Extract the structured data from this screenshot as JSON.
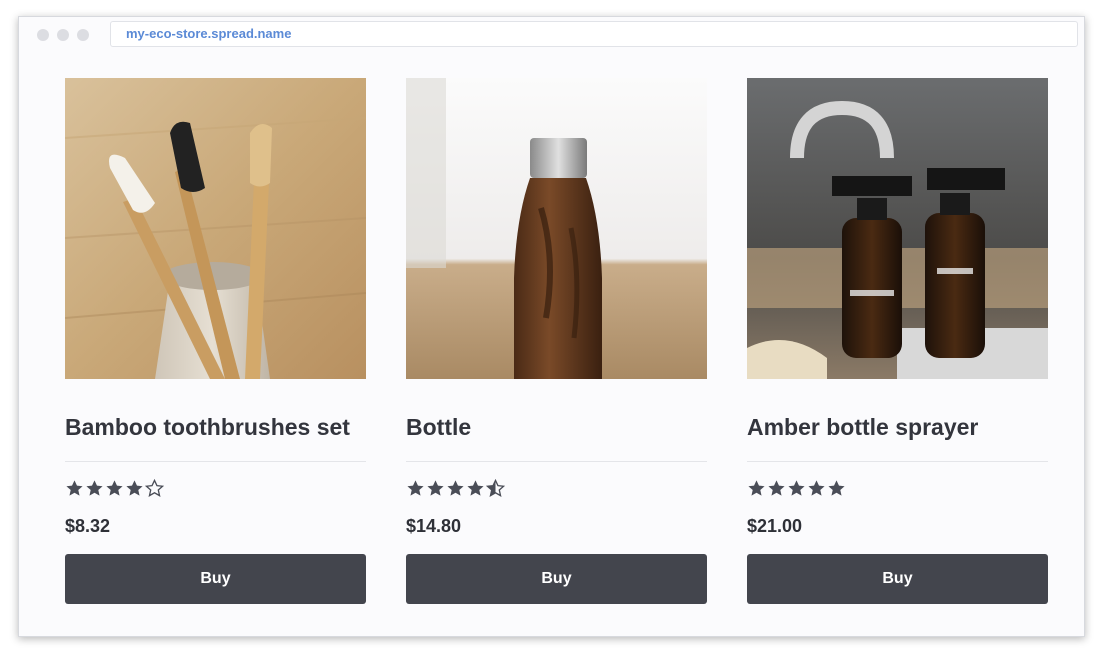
{
  "browser": {
    "url": "my-eco-store.spread.name"
  },
  "products": [
    {
      "title": "Bamboo toothbrushes set",
      "rating": 4,
      "price": "$8.32",
      "buy_label": "Buy",
      "image": "bamboo-toothbrushes-photo"
    },
    {
      "title": "Bottle",
      "rating": 4.5,
      "price": "$14.80",
      "buy_label": "Buy",
      "image": "wooden-bottle-photo"
    },
    {
      "title": "Amber bottle sprayer",
      "rating": 5,
      "price": "$21.00",
      "buy_label": "Buy",
      "image": "amber-sprayer-bottles-photo"
    }
  ],
  "colors": {
    "button": "#43454d",
    "star": "#4a4d57",
    "url_text": "#5b8ad6"
  }
}
